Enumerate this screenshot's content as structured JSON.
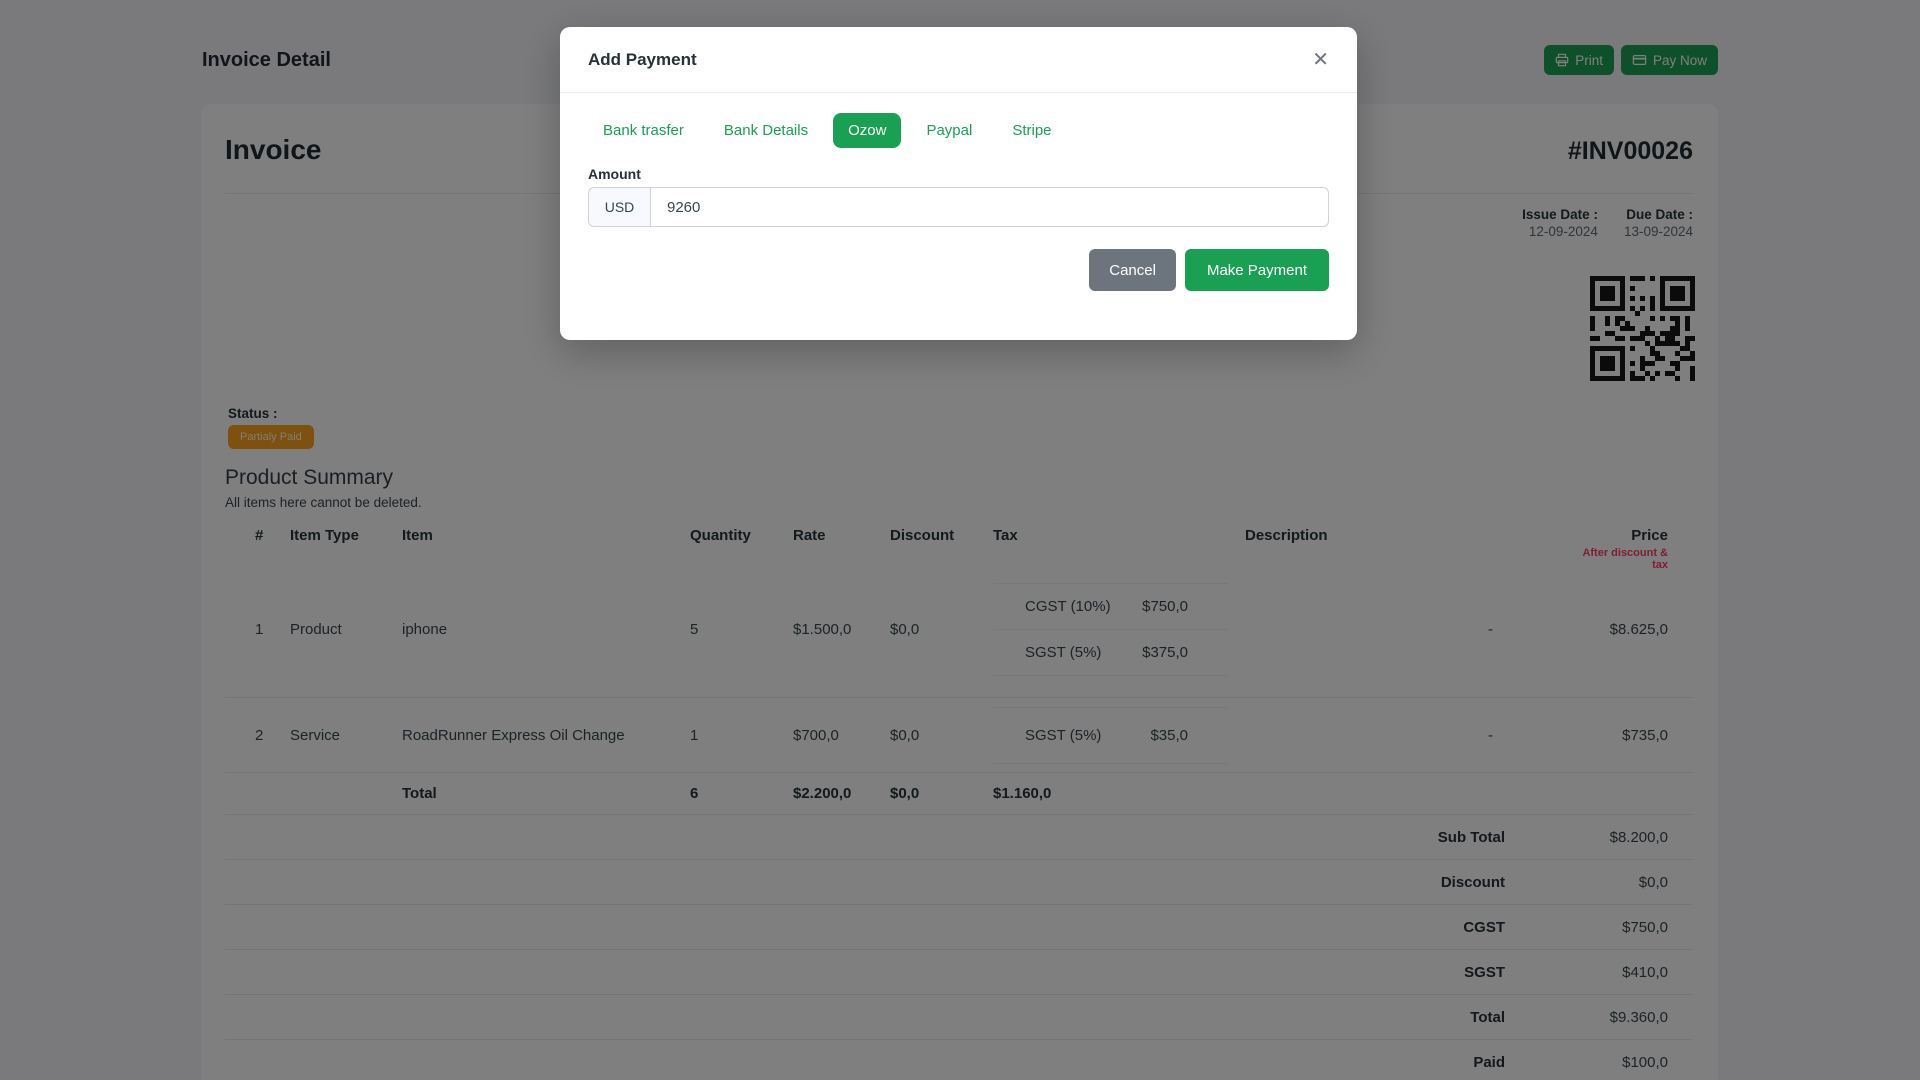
{
  "colors": {
    "green": "#1aa053",
    "amber": "#ffa21d",
    "red": "#ff3a6d"
  },
  "page": {
    "title": "Invoice Detail"
  },
  "actions": {
    "print": "Print",
    "pay_now": "Pay Now"
  },
  "invoice": {
    "heading": "Invoice",
    "number": "#INV00026",
    "issue_date_label": "Issue Date :",
    "issue_date": "12-09-2024",
    "due_date_label": "Due Date :",
    "due_date": "13-09-2024",
    "status_label": "Status :",
    "status": "Partialy Paid"
  },
  "product_summary": {
    "title": "Product Summary",
    "note": "All items here cannot be deleted."
  },
  "table": {
    "headers": {
      "index": "#",
      "item_type": "Item Type",
      "item": "Item",
      "quantity": "Quantity",
      "rate": "Rate",
      "discount": "Discount",
      "tax": "Tax",
      "description": "Description",
      "price": "Price",
      "price_sub": "After discount & tax"
    },
    "rows": [
      {
        "index": "1",
        "item_type": "Product",
        "item": "iphone",
        "quantity": "5",
        "rate": "$1.500,0",
        "discount": "$0,0",
        "taxes": [
          {
            "label": "CGST (10%)",
            "amount": "$750,0"
          },
          {
            "label": "SGST (5%)",
            "amount": "$375,0"
          }
        ],
        "description": "-",
        "price": "$8.625,0"
      },
      {
        "index": "2",
        "item_type": "Service",
        "item": "RoadRunner Express Oil Change",
        "quantity": "1",
        "rate": "$700,0",
        "discount": "$0,0",
        "taxes": [
          {
            "label": "SGST (5%)",
            "amount": "$35,0"
          }
        ],
        "description": "-",
        "price": "$735,0"
      }
    ],
    "totals": {
      "label": "Total",
      "quantity": "6",
      "rate": "$2.200,0",
      "discount": "$0,0",
      "tax": "$1.160,0"
    },
    "summary": [
      {
        "label": "Sub Total",
        "value": "$8.200,0"
      },
      {
        "label": "Discount",
        "value": "$0,0"
      },
      {
        "label": "CGST",
        "value": "$750,0"
      },
      {
        "label": "SGST",
        "value": "$410,0"
      },
      {
        "label": "Total",
        "value": "$9.360,0"
      },
      {
        "label": "Paid",
        "value": "$100,0"
      }
    ]
  },
  "modal": {
    "title": "Add Payment",
    "close": "✕",
    "tabs": [
      {
        "label": "Bank trasfer",
        "active": false
      },
      {
        "label": "Bank Details",
        "active": false
      },
      {
        "label": "Ozow",
        "active": true
      },
      {
        "label": "Paypal",
        "active": false
      },
      {
        "label": "Stripe",
        "active": false
      }
    ],
    "amount_label": "Amount",
    "currency": "USD",
    "amount_value": "9260",
    "cancel": "Cancel",
    "submit": "Make Payment"
  }
}
